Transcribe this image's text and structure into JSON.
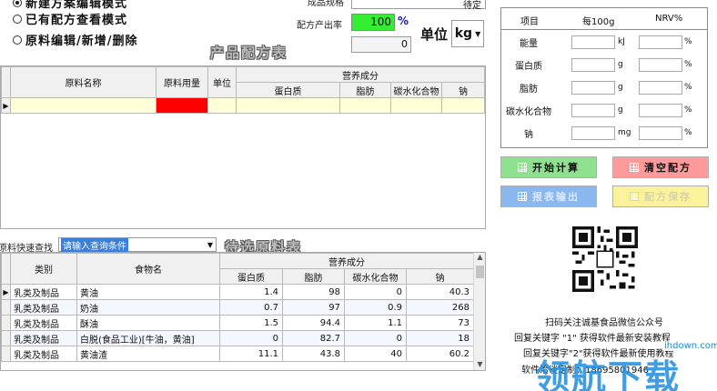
{
  "modes": {
    "new": "新建方案编辑模式",
    "view": "已有配方查看模式",
    "edit": "原料编辑/新增/删除"
  },
  "top": {
    "spec_label": "成品规格",
    "spec_value": "待定",
    "yield_label": "配方产出率",
    "yield_value": "100",
    "yield_unit": "%",
    "yield_sub_value": "0",
    "unit_label": "单位",
    "unit_value": "kg",
    "product_table_title": "产品配方表"
  },
  "recipe_table": {
    "col_name": "原料名称",
    "col_amount": "原料用量",
    "col_unit": "单位",
    "group_header": "营养成分",
    "col_protein": "蛋白质",
    "col_fat": "脂肪",
    "col_carb": "碳水化合物",
    "col_sodium": "钠",
    "row_marker": "▶"
  },
  "search": {
    "label": "原料快速查找",
    "value": "请输入查询条件",
    "title": "待选原料表"
  },
  "food_table": {
    "col_category": "类别",
    "col_name": "食物名",
    "group_header": "营养成分",
    "col_protein": "蛋白质",
    "col_fat": "脂肪",
    "col_carb": "碳水化合物",
    "col_sodium": "钠",
    "rows": [
      {
        "category": "乳类及制品",
        "name": "黄油",
        "protein": "1.4",
        "fat": "98",
        "carb": "0",
        "sodium": "40.3"
      },
      {
        "category": "乳类及制品",
        "name": "奶油",
        "protein": "0.7",
        "fat": "97",
        "carb": "0.9",
        "sodium": "268"
      },
      {
        "category": "乳类及制品",
        "name": "酥油",
        "protein": "1.5",
        "fat": "94.4",
        "carb": "1.1",
        "sodium": "73"
      },
      {
        "category": "乳类及制品",
        "name": "白脱(食品工业)[牛油，黄油]",
        "protein": "0",
        "fat": "82.7",
        "carb": "0",
        "sodium": "18"
      },
      {
        "category": "乳类及制品",
        "name": "黄油渣",
        "protein": "11.1",
        "fat": "43.8",
        "carb": "40",
        "sodium": "60.2"
      }
    ]
  },
  "nutrition": {
    "head_item": "项目",
    "head_per100": "每100g",
    "head_nrv": "NRV%",
    "rows": [
      {
        "name": "能量",
        "unit": "kJ",
        "pct": "%"
      },
      {
        "name": "蛋白质",
        "unit": "g",
        "pct": "%"
      },
      {
        "name": "脂肪",
        "unit": "g",
        "pct": "%"
      },
      {
        "name": "碳水化合物",
        "unit": "g",
        "pct": "%"
      },
      {
        "name": "钠",
        "unit": "mg",
        "pct": "%"
      }
    ]
  },
  "buttons": {
    "start": "开始计算",
    "clear": "清空配方",
    "export": "报表输出",
    "save": "配方保存"
  },
  "colors": {
    "start": "#8fe08f",
    "clear": "#ff9a9a",
    "export": "#8ab8ee",
    "save": "#fbf39c",
    "yield_bg": "#33ee33",
    "amount_cell": "#ff0000",
    "row_highlight": "#ffffd8"
  },
  "info": {
    "line1": "扫码关注诚基食品微信公众号",
    "line2": "回复关键字 \"1\" 获得软件最新安装教程",
    "line3": "回复关键字\"2\"获得软件最新使用教程",
    "line4": "软件洽谈定制：18695801946",
    "watermark_small": "ihdown.com",
    "watermark_big": "领航下载"
  }
}
